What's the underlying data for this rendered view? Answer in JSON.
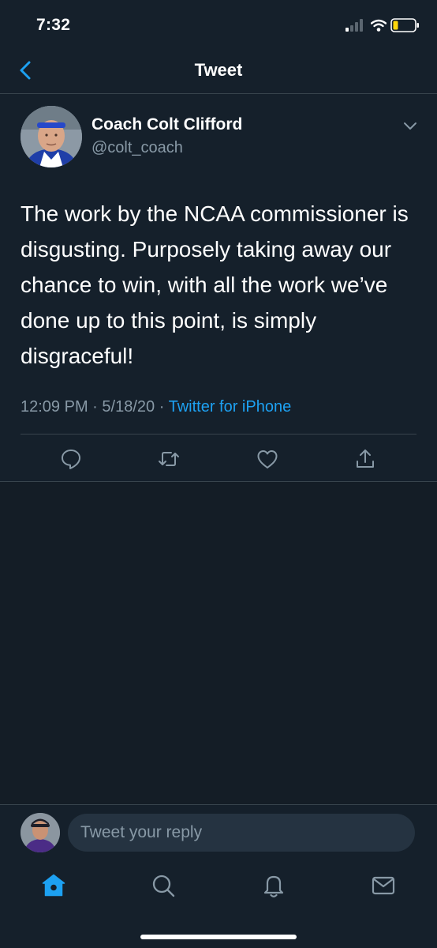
{
  "status_bar": {
    "time": "7:32"
  },
  "nav": {
    "title": "Tweet",
    "back_icon": "chevron-left-icon"
  },
  "tweet": {
    "author_name": "Coach Colt Clifford",
    "author_handle": "@colt_coach",
    "text": "The work by the NCAA commissioner is disgusting. Purposely taking away our chance to win, with all the work we’ve done up to this point, is simply disgraceful!",
    "time": "12:09 PM",
    "date": "5/18/20",
    "separator": "·",
    "source": "Twitter for iPhone",
    "actions": [
      "reply-icon",
      "retweet-icon",
      "like-icon",
      "share-icon"
    ]
  },
  "reply": {
    "placeholder": "Tweet your reply"
  },
  "tab_bar": {
    "items": [
      "home-icon",
      "search-icon",
      "notifications-icon",
      "messages-icon"
    ],
    "active": "home-icon"
  },
  "colors": {
    "background": "#15202b",
    "accent": "#1da1f2",
    "secondary_text": "#8899a6",
    "border": "#38444d"
  }
}
